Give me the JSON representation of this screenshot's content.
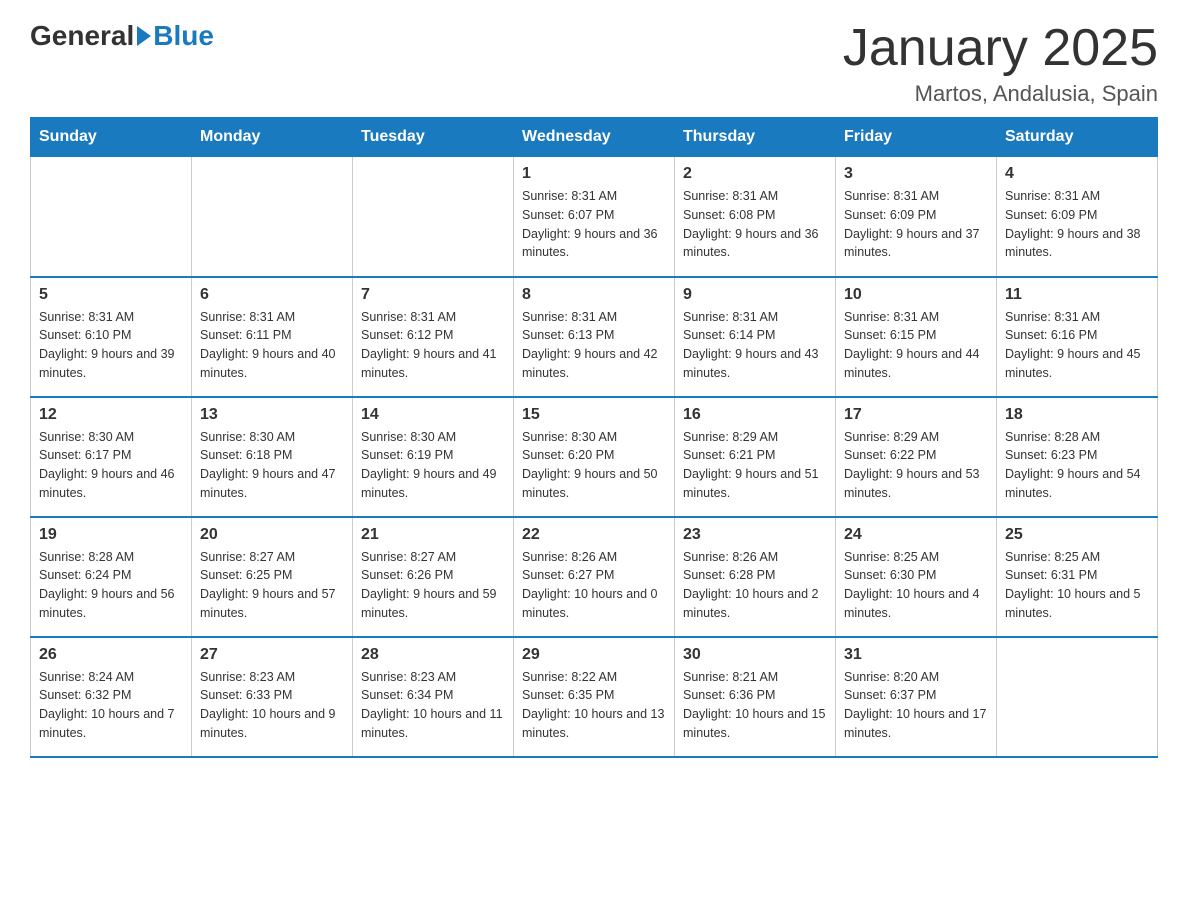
{
  "logo": {
    "general": "General",
    "blue": "Blue"
  },
  "title": "January 2025",
  "location": "Martos, Andalusia, Spain",
  "days_of_week": [
    "Sunday",
    "Monday",
    "Tuesday",
    "Wednesday",
    "Thursday",
    "Friday",
    "Saturday"
  ],
  "weeks": [
    [
      {
        "day": "",
        "info": ""
      },
      {
        "day": "",
        "info": ""
      },
      {
        "day": "",
        "info": ""
      },
      {
        "day": "1",
        "info": "Sunrise: 8:31 AM\nSunset: 6:07 PM\nDaylight: 9 hours and 36 minutes."
      },
      {
        "day": "2",
        "info": "Sunrise: 8:31 AM\nSunset: 6:08 PM\nDaylight: 9 hours and 36 minutes."
      },
      {
        "day": "3",
        "info": "Sunrise: 8:31 AM\nSunset: 6:09 PM\nDaylight: 9 hours and 37 minutes."
      },
      {
        "day": "4",
        "info": "Sunrise: 8:31 AM\nSunset: 6:09 PM\nDaylight: 9 hours and 38 minutes."
      }
    ],
    [
      {
        "day": "5",
        "info": "Sunrise: 8:31 AM\nSunset: 6:10 PM\nDaylight: 9 hours and 39 minutes."
      },
      {
        "day": "6",
        "info": "Sunrise: 8:31 AM\nSunset: 6:11 PM\nDaylight: 9 hours and 40 minutes."
      },
      {
        "day": "7",
        "info": "Sunrise: 8:31 AM\nSunset: 6:12 PM\nDaylight: 9 hours and 41 minutes."
      },
      {
        "day": "8",
        "info": "Sunrise: 8:31 AM\nSunset: 6:13 PM\nDaylight: 9 hours and 42 minutes."
      },
      {
        "day": "9",
        "info": "Sunrise: 8:31 AM\nSunset: 6:14 PM\nDaylight: 9 hours and 43 minutes."
      },
      {
        "day": "10",
        "info": "Sunrise: 8:31 AM\nSunset: 6:15 PM\nDaylight: 9 hours and 44 minutes."
      },
      {
        "day": "11",
        "info": "Sunrise: 8:31 AM\nSunset: 6:16 PM\nDaylight: 9 hours and 45 minutes."
      }
    ],
    [
      {
        "day": "12",
        "info": "Sunrise: 8:30 AM\nSunset: 6:17 PM\nDaylight: 9 hours and 46 minutes."
      },
      {
        "day": "13",
        "info": "Sunrise: 8:30 AM\nSunset: 6:18 PM\nDaylight: 9 hours and 47 minutes."
      },
      {
        "day": "14",
        "info": "Sunrise: 8:30 AM\nSunset: 6:19 PM\nDaylight: 9 hours and 49 minutes."
      },
      {
        "day": "15",
        "info": "Sunrise: 8:30 AM\nSunset: 6:20 PM\nDaylight: 9 hours and 50 minutes."
      },
      {
        "day": "16",
        "info": "Sunrise: 8:29 AM\nSunset: 6:21 PM\nDaylight: 9 hours and 51 minutes."
      },
      {
        "day": "17",
        "info": "Sunrise: 8:29 AM\nSunset: 6:22 PM\nDaylight: 9 hours and 53 minutes."
      },
      {
        "day": "18",
        "info": "Sunrise: 8:28 AM\nSunset: 6:23 PM\nDaylight: 9 hours and 54 minutes."
      }
    ],
    [
      {
        "day": "19",
        "info": "Sunrise: 8:28 AM\nSunset: 6:24 PM\nDaylight: 9 hours and 56 minutes."
      },
      {
        "day": "20",
        "info": "Sunrise: 8:27 AM\nSunset: 6:25 PM\nDaylight: 9 hours and 57 minutes."
      },
      {
        "day": "21",
        "info": "Sunrise: 8:27 AM\nSunset: 6:26 PM\nDaylight: 9 hours and 59 minutes."
      },
      {
        "day": "22",
        "info": "Sunrise: 8:26 AM\nSunset: 6:27 PM\nDaylight: 10 hours and 0 minutes."
      },
      {
        "day": "23",
        "info": "Sunrise: 8:26 AM\nSunset: 6:28 PM\nDaylight: 10 hours and 2 minutes."
      },
      {
        "day": "24",
        "info": "Sunrise: 8:25 AM\nSunset: 6:30 PM\nDaylight: 10 hours and 4 minutes."
      },
      {
        "day": "25",
        "info": "Sunrise: 8:25 AM\nSunset: 6:31 PM\nDaylight: 10 hours and 5 minutes."
      }
    ],
    [
      {
        "day": "26",
        "info": "Sunrise: 8:24 AM\nSunset: 6:32 PM\nDaylight: 10 hours and 7 minutes."
      },
      {
        "day": "27",
        "info": "Sunrise: 8:23 AM\nSunset: 6:33 PM\nDaylight: 10 hours and 9 minutes."
      },
      {
        "day": "28",
        "info": "Sunrise: 8:23 AM\nSunset: 6:34 PM\nDaylight: 10 hours and 11 minutes."
      },
      {
        "day": "29",
        "info": "Sunrise: 8:22 AM\nSunset: 6:35 PM\nDaylight: 10 hours and 13 minutes."
      },
      {
        "day": "30",
        "info": "Sunrise: 8:21 AM\nSunset: 6:36 PM\nDaylight: 10 hours and 15 minutes."
      },
      {
        "day": "31",
        "info": "Sunrise: 8:20 AM\nSunset: 6:37 PM\nDaylight: 10 hours and 17 minutes."
      },
      {
        "day": "",
        "info": ""
      }
    ]
  ]
}
